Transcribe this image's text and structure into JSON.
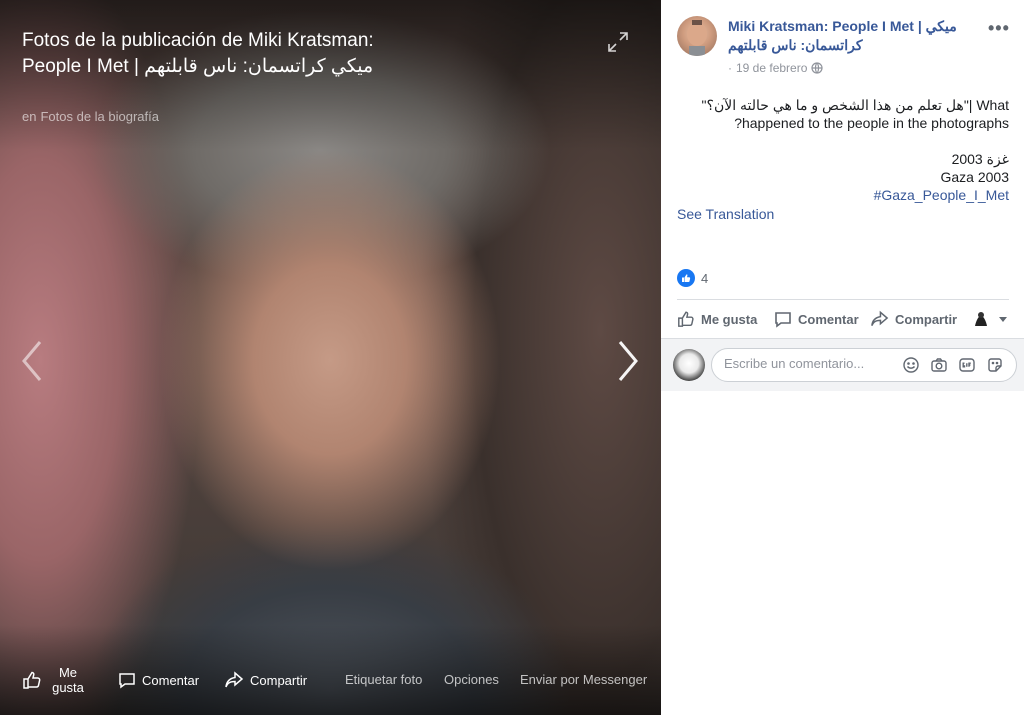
{
  "viewer": {
    "album_title": "Fotos de la publicación de Miki Kratsman: People I Met | ميكي كراتسمان: ناس قابلتهم",
    "album_sub_prefix": "en",
    "album_sub_link": "Fotos de la biografía",
    "actions": {
      "like": "Me gusta",
      "comment": "Comentar",
      "share": "Compartir",
      "tag": "Etiquetar foto",
      "options": "Opciones",
      "send": "Enviar por Messenger"
    }
  },
  "post": {
    "page_name": "Miki Kratsman: People I Met | ميكي كراتسمان: ناس قابلتهم",
    "date": "19 de febrero",
    "dot": "·",
    "more": "•••",
    "text_line1": "\"هل تعلم من هذا الشخص و ما هي حالته الآن؟\"| What",
    "text_line2": "?happened to the people in the photographs",
    "text_line3": "غزة 2003",
    "text_line4": "Gaza 2003",
    "hashtag": "#Gaza_People_I_Met",
    "see_translation": "See Translation",
    "reaction_count": "4"
  },
  "actions": {
    "like": "Me gusta",
    "comment": "Comentar",
    "share": "Compartir"
  },
  "comment_box": {
    "placeholder": "Escribe un comentario..."
  },
  "colors": {
    "link": "#385898",
    "like_blue": "#1877f2",
    "muted": "#606770"
  }
}
